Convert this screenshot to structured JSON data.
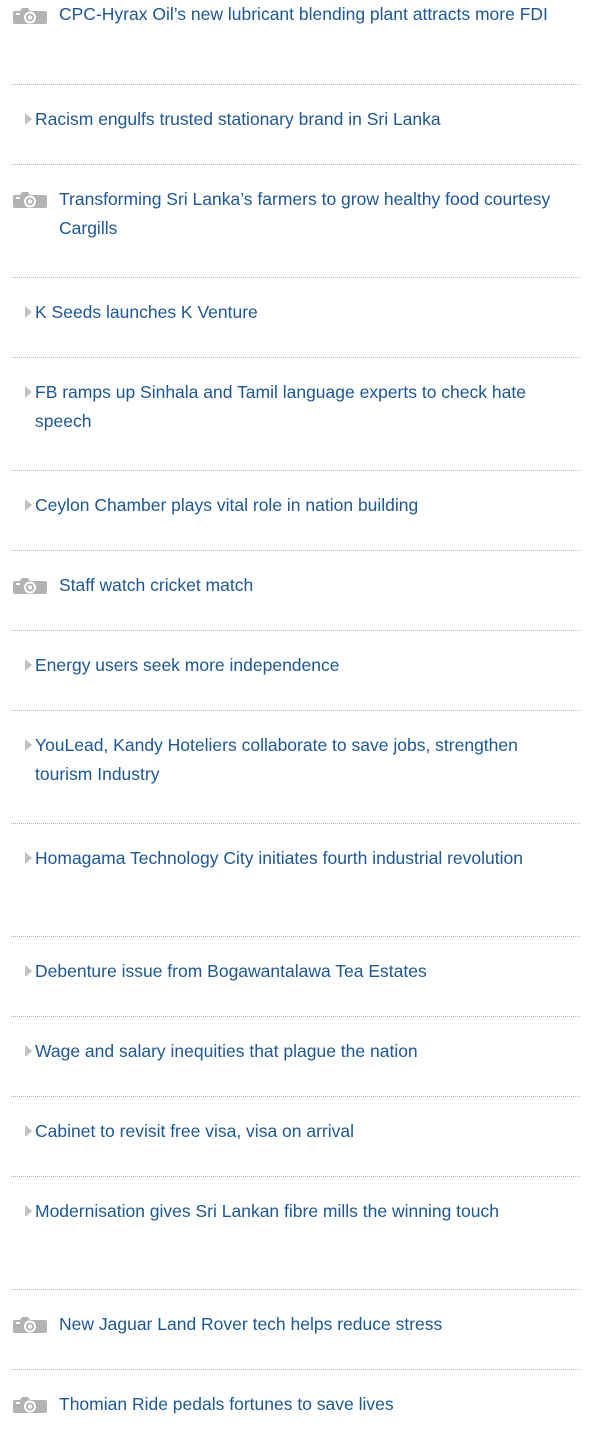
{
  "articles": [
    {
      "title": "CPC-Hyrax Oil’s new lubricant blending plant attracts more FDI",
      "icon": "camera-icon"
    },
    {
      "title": "Racism engulfs trusted stationary brand in Sri Lanka",
      "icon": "arrow-icon"
    },
    {
      "title": "Transforming Sri Lanka’s farmers to grow healthy food courtesy Cargills",
      "icon": "camera-icon"
    },
    {
      "title": "K Seeds launches K Venture",
      "icon": "arrow-icon"
    },
    {
      "title": "FB ramps up Sinhala and Tamil language experts to check hate speech",
      "icon": "arrow-icon"
    },
    {
      "title": "Ceylon Chamber plays vital role in nation building",
      "icon": "arrow-icon"
    },
    {
      "title": "Staff watch cricket match",
      "icon": "camera-icon"
    },
    {
      "title": "Energy users seek more independence",
      "icon": "arrow-icon"
    },
    {
      "title": "YouLead, Kandy Hoteliers collaborate to save jobs, strengthen tourism Industry",
      "icon": "arrow-icon"
    },
    {
      "title": "Homagama Technology City initiates fourth industrial revolution",
      "icon": "arrow-icon"
    },
    {
      "title": "Debenture issue from Bogawantalawa Tea Estates",
      "icon": "arrow-icon"
    },
    {
      "title": "Wage and salary inequities that plague the nation",
      "icon": "arrow-icon"
    },
    {
      "title": "Cabinet to revisit free visa, visa on arrival",
      "icon": "arrow-icon"
    },
    {
      "title": "Modernisation gives Sri Lankan fibre mills the winning touch",
      "icon": "arrow-icon"
    },
    {
      "title": "New Jaguar Land Rover tech helps reduce stress",
      "icon": "camera-icon"
    },
    {
      "title": "Thomian Ride pedals fortunes to save lives",
      "icon": "camera-icon"
    }
  ],
  "colors": {
    "link": "#1d5795",
    "divider": "#b7b7b7",
    "arrow": "#c2c2c2",
    "camera": "#b3b3b3"
  }
}
